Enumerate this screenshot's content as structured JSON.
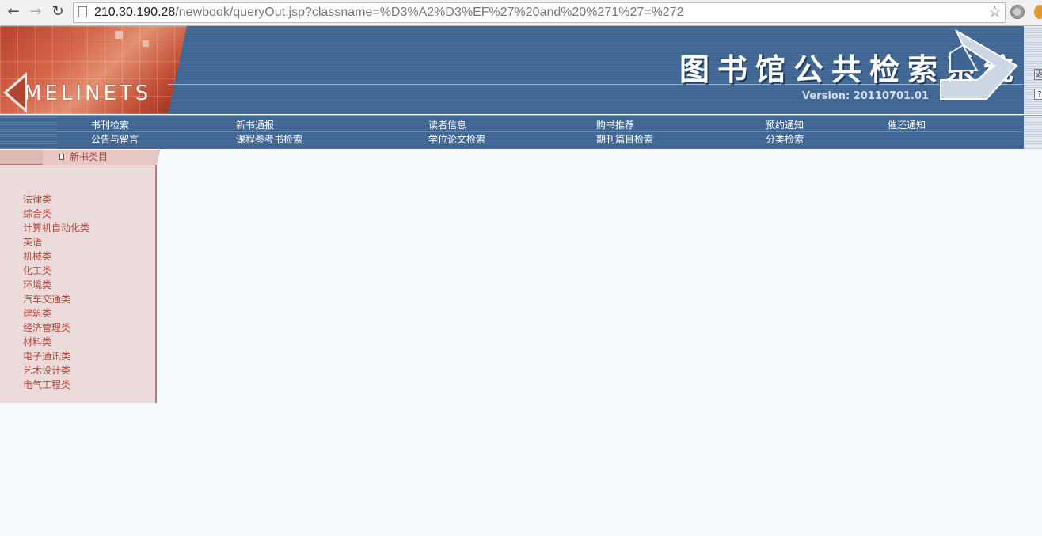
{
  "browser": {
    "url_host": "210.30.190.28",
    "url_path": "/newbook/queryOut.jsp?classname=%D3%A2%D3%EF%27%20and%20%271%27=%272",
    "back_icon": "back-arrow-icon",
    "forward_icon": "forward-arrow-icon",
    "reload_icon": "reload-icon",
    "bookmark_icon": "star-icon"
  },
  "header": {
    "logo_text": "MELINETS",
    "title": "图书馆公共检索系统",
    "version": "Version: 20110701.01",
    "side_buttons": [
      "返",
      "?"
    ]
  },
  "nav": {
    "row1": [
      "书刊检索",
      "新书通报",
      "读者信息",
      "购书推荐",
      "预约通知",
      "催还通知"
    ],
    "row2": [
      "公告与留言",
      "课程参考书检索",
      "学位论文检索",
      "期刊篇目检索",
      "分类检索"
    ]
  },
  "sidebar": {
    "title": "新书类目",
    "categories": [
      "法律类",
      "综合类",
      "计算机自动化类",
      "英语",
      "机械类",
      "化工类",
      "环境类",
      "汽车交通类",
      "建筑类",
      "经济管理类",
      "材料类",
      "电子通讯类",
      "艺术设计类",
      "电气工程类"
    ]
  },
  "colors": {
    "header_blue": "#3f6592",
    "sidebar_bg": "#ebdbdb",
    "link_red": "#b04a3c",
    "page_bg": "#f6f9fe"
  }
}
